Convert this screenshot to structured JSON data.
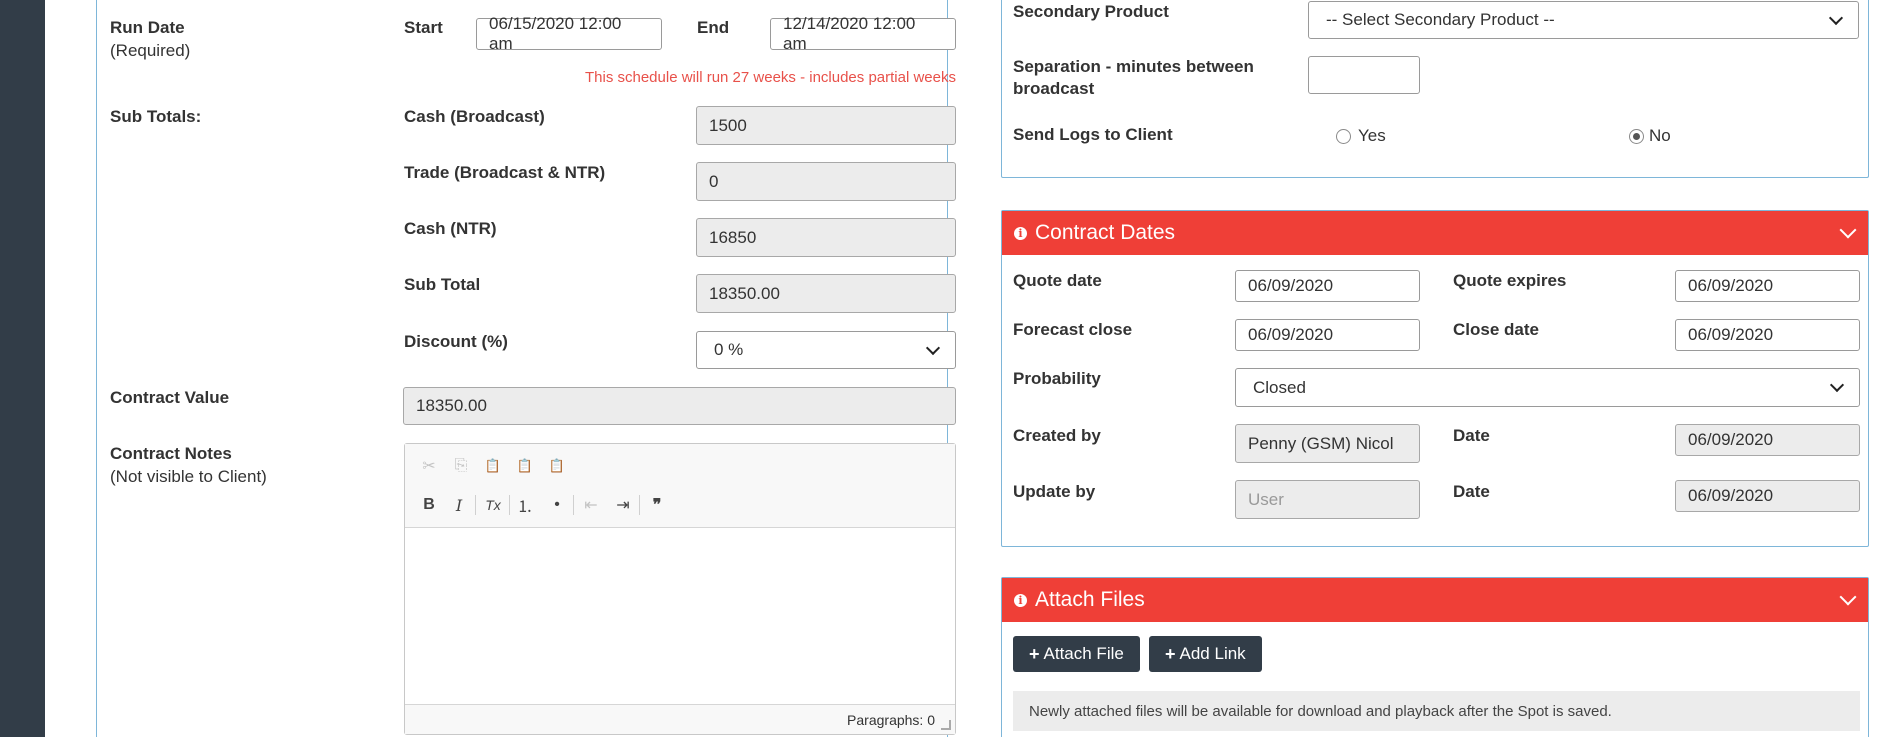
{
  "run_date": {
    "label": "Run Date",
    "required": "(Required)",
    "start_label": "Start",
    "start_value": "06/15/2020 12:00 am",
    "end_label": "End",
    "end_value": "12/14/2020 12:00 am",
    "notice": "This schedule will run 27 weeks - includes partial weeks"
  },
  "subtotals": {
    "label": "Sub Totals:",
    "cash_broadcast_label": "Cash (Broadcast)",
    "cash_broadcast_value": "1500",
    "trade_label": "Trade (Broadcast & NTR)",
    "trade_value": "0",
    "cash_ntr_label": "Cash (NTR)",
    "cash_ntr_value": "16850",
    "sub_total_label": "Sub Total",
    "sub_total_value": "18350.00",
    "discount_label": "Discount (%)",
    "discount_value": "0 %"
  },
  "contract_value": {
    "label": "Contract Value",
    "value": "18350.00"
  },
  "contract_notes": {
    "label": "Contract Notes",
    "sub": "(Not visible to Client)",
    "status": "Paragraphs: 0",
    "toolbar": {
      "cut": "✂",
      "copy": "⎘",
      "paste": "📋",
      "paste_text": "📋",
      "paste_word": "📋",
      "bold": "B",
      "italic": "I",
      "remove_format": "Tx",
      "numbered_list": "⒈",
      "bulleted_list": "•",
      "outdent": "⇤",
      "indent": "⇥",
      "blockquote": "❞"
    }
  },
  "right_top": {
    "secondary_product_label": "Secondary Product",
    "secondary_product_value": "-- Select Secondary Product --",
    "separation_label_1": "Separation - minutes between",
    "separation_label_2": "broadcast",
    "separation_value": "",
    "send_logs_label": "Send Logs to Client",
    "yes_label": "Yes",
    "no_label": "No"
  },
  "contract_dates": {
    "title": "Contract Dates",
    "quote_date_label": "Quote date",
    "quote_date_value": "06/09/2020",
    "quote_expires_label": "Quote expires",
    "quote_expires_value": "06/09/2020",
    "forecast_close_label": "Forecast close",
    "forecast_close_value": "06/09/2020",
    "close_date_label": "Close date",
    "close_date_value": "06/09/2020",
    "probability_label": "Probability",
    "probability_value": "Closed",
    "created_by_label": "Created by",
    "created_by_value": "Penny (GSM) Nicol",
    "created_date_label": "Date",
    "created_date_value": "06/09/2020",
    "update_by_label": "Update by",
    "update_by_placeholder": "User",
    "update_date_label": "Date",
    "update_date_value": "06/09/2020"
  },
  "attach_files": {
    "title": "Attach Files",
    "attach_button": "Attach File",
    "add_link_button": "Add Link",
    "notice": "Newly attached files will be available for download and playback after the Spot is saved."
  },
  "colors": {
    "sidebar": "#323d48",
    "accent": "#ef3f37",
    "border": "#7eb6d9",
    "warning_text": "#e8514a"
  }
}
